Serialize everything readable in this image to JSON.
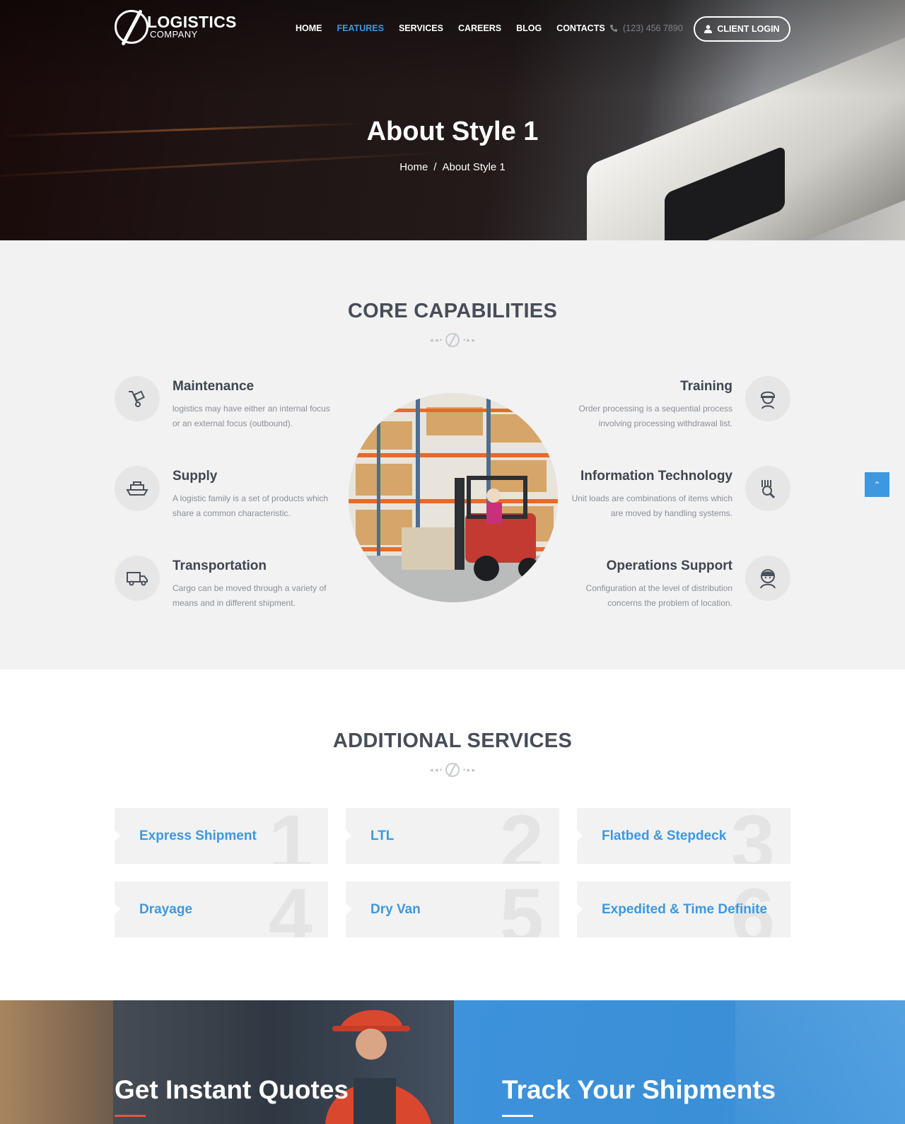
{
  "nav": {
    "logo_line1": "LOGISTICS",
    "logo_line2": "COMPANY",
    "items": [
      {
        "label": "HOME",
        "active": false
      },
      {
        "label": "FEATURES",
        "active": true
      },
      {
        "label": "SERVICES",
        "active": false
      },
      {
        "label": "CAREERS",
        "active": false
      },
      {
        "label": "BLOG",
        "active": false
      },
      {
        "label": "CONTACTS",
        "active": false
      }
    ],
    "phone": "(123) 456 7890",
    "login_label": "CLIENT LOGIN"
  },
  "hero": {
    "title": "About Style 1",
    "breadcrumb": [
      "Home",
      "/",
      "About Style 1"
    ]
  },
  "core": {
    "title": "CORE CAPABILITIES",
    "left": [
      {
        "title": "Maintenance",
        "text_line1": "logistics may have either an internal focus",
        "text_line2": "or an external focus (outbound).",
        "icon": "hand-truck-icon"
      },
      {
        "title": "Supply",
        "text_line1": "A logistic family is a set of products which",
        "text_line2": "share a common characteristic.",
        "icon": "ship-icon"
      },
      {
        "title": "Transportation",
        "text_line1": "Cargo can be moved through a variety of",
        "text_line2": "means and in different shipment.",
        "icon": "truck-icon"
      }
    ],
    "right": [
      {
        "title": "Training",
        "text_line1": "Order processing is a sequential process",
        "text_line2": "involving processing withdrawal list.",
        "icon": "worker-icon"
      },
      {
        "title": "Information Technology",
        "text_line1": "Unit loads are combinations of items which",
        "text_line2": "are moved by handling systems.",
        "icon": "barcode-search-icon"
      },
      {
        "title": "Operations Support",
        "text_line1": "Configuration at the level of distribution",
        "text_line2": "concerns the problem of location.",
        "icon": "support-agent-icon"
      }
    ]
  },
  "services": {
    "title": "ADDITIONAL SERVICES",
    "items": [
      {
        "label": "Express Shipment",
        "num": "1"
      },
      {
        "label": "LTL",
        "num": "2"
      },
      {
        "label": "Flatbed & Stepdeck",
        "num": "3"
      },
      {
        "label": "Drayage",
        "num": "4"
      },
      {
        "label": "Dry Van",
        "num": "5"
      },
      {
        "label": "Expedited & Time Definite",
        "num": "6"
      }
    ]
  },
  "bottom": {
    "left_title": "Get Instant Quotes",
    "right_title": "Track Your Shipments"
  },
  "colors": {
    "accent": "#3d98df",
    "quote_underline": "#e0583b",
    "track_underline": "#ffffff"
  }
}
